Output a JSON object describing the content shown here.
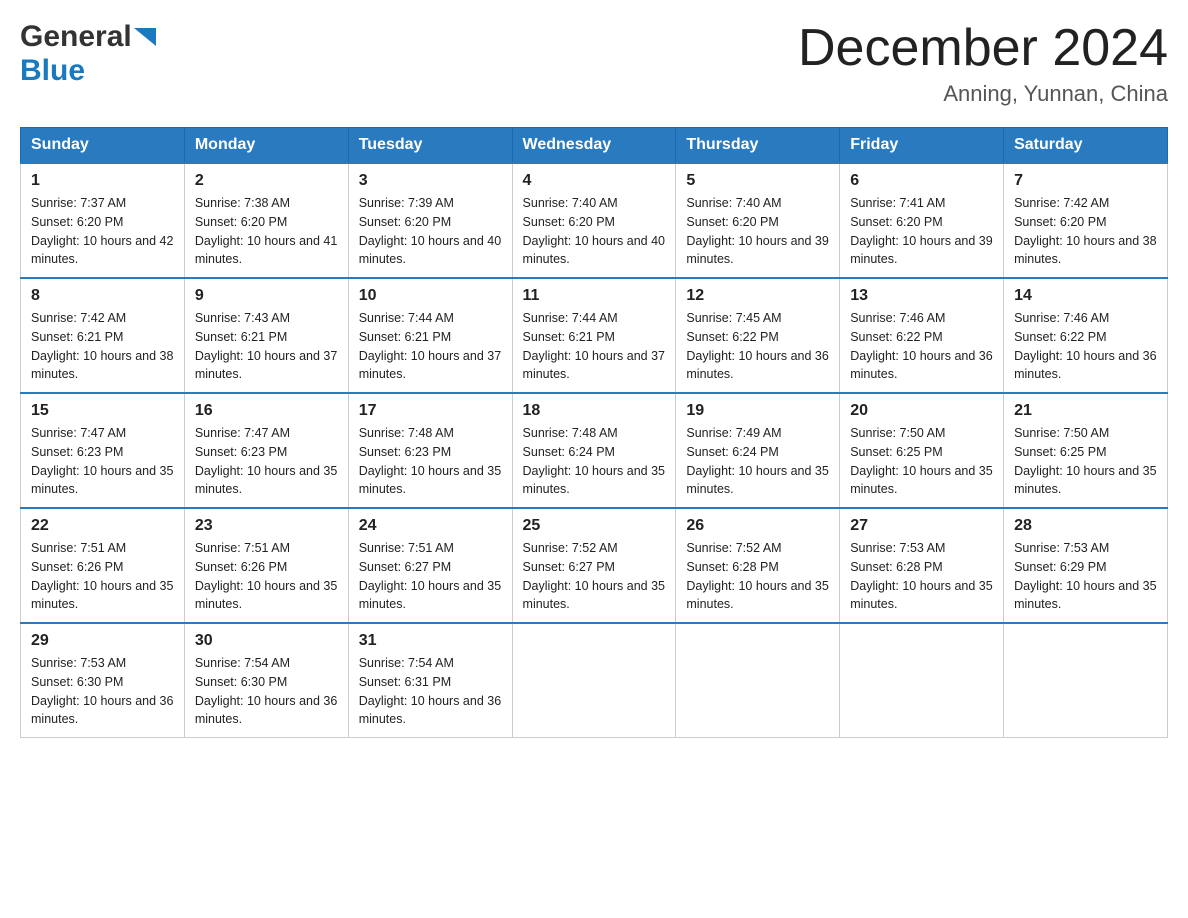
{
  "header": {
    "logo_general": "General",
    "logo_blue": "Blue",
    "month_year": "December 2024",
    "location": "Anning, Yunnan, China"
  },
  "weekdays": [
    "Sunday",
    "Monday",
    "Tuesday",
    "Wednesday",
    "Thursday",
    "Friday",
    "Saturday"
  ],
  "weeks": [
    [
      {
        "day": "1",
        "sunrise": "7:37 AM",
        "sunset": "6:20 PM",
        "daylight": "10 hours and 42 minutes."
      },
      {
        "day": "2",
        "sunrise": "7:38 AM",
        "sunset": "6:20 PM",
        "daylight": "10 hours and 41 minutes."
      },
      {
        "day": "3",
        "sunrise": "7:39 AM",
        "sunset": "6:20 PM",
        "daylight": "10 hours and 40 minutes."
      },
      {
        "day": "4",
        "sunrise": "7:40 AM",
        "sunset": "6:20 PM",
        "daylight": "10 hours and 40 minutes."
      },
      {
        "day": "5",
        "sunrise": "7:40 AM",
        "sunset": "6:20 PM",
        "daylight": "10 hours and 39 minutes."
      },
      {
        "day": "6",
        "sunrise": "7:41 AM",
        "sunset": "6:20 PM",
        "daylight": "10 hours and 39 minutes."
      },
      {
        "day": "7",
        "sunrise": "7:42 AM",
        "sunset": "6:20 PM",
        "daylight": "10 hours and 38 minutes."
      }
    ],
    [
      {
        "day": "8",
        "sunrise": "7:42 AM",
        "sunset": "6:21 PM",
        "daylight": "10 hours and 38 minutes."
      },
      {
        "day": "9",
        "sunrise": "7:43 AM",
        "sunset": "6:21 PM",
        "daylight": "10 hours and 37 minutes."
      },
      {
        "day": "10",
        "sunrise": "7:44 AM",
        "sunset": "6:21 PM",
        "daylight": "10 hours and 37 minutes."
      },
      {
        "day": "11",
        "sunrise": "7:44 AM",
        "sunset": "6:21 PM",
        "daylight": "10 hours and 37 minutes."
      },
      {
        "day": "12",
        "sunrise": "7:45 AM",
        "sunset": "6:22 PM",
        "daylight": "10 hours and 36 minutes."
      },
      {
        "day": "13",
        "sunrise": "7:46 AM",
        "sunset": "6:22 PM",
        "daylight": "10 hours and 36 minutes."
      },
      {
        "day": "14",
        "sunrise": "7:46 AM",
        "sunset": "6:22 PM",
        "daylight": "10 hours and 36 minutes."
      }
    ],
    [
      {
        "day": "15",
        "sunrise": "7:47 AM",
        "sunset": "6:23 PM",
        "daylight": "10 hours and 35 minutes."
      },
      {
        "day": "16",
        "sunrise": "7:47 AM",
        "sunset": "6:23 PM",
        "daylight": "10 hours and 35 minutes."
      },
      {
        "day": "17",
        "sunrise": "7:48 AM",
        "sunset": "6:23 PM",
        "daylight": "10 hours and 35 minutes."
      },
      {
        "day": "18",
        "sunrise": "7:48 AM",
        "sunset": "6:24 PM",
        "daylight": "10 hours and 35 minutes."
      },
      {
        "day": "19",
        "sunrise": "7:49 AM",
        "sunset": "6:24 PM",
        "daylight": "10 hours and 35 minutes."
      },
      {
        "day": "20",
        "sunrise": "7:50 AM",
        "sunset": "6:25 PM",
        "daylight": "10 hours and 35 minutes."
      },
      {
        "day": "21",
        "sunrise": "7:50 AM",
        "sunset": "6:25 PM",
        "daylight": "10 hours and 35 minutes."
      }
    ],
    [
      {
        "day": "22",
        "sunrise": "7:51 AM",
        "sunset": "6:26 PM",
        "daylight": "10 hours and 35 minutes."
      },
      {
        "day": "23",
        "sunrise": "7:51 AM",
        "sunset": "6:26 PM",
        "daylight": "10 hours and 35 minutes."
      },
      {
        "day": "24",
        "sunrise": "7:51 AM",
        "sunset": "6:27 PM",
        "daylight": "10 hours and 35 minutes."
      },
      {
        "day": "25",
        "sunrise": "7:52 AM",
        "sunset": "6:27 PM",
        "daylight": "10 hours and 35 minutes."
      },
      {
        "day": "26",
        "sunrise": "7:52 AM",
        "sunset": "6:28 PM",
        "daylight": "10 hours and 35 minutes."
      },
      {
        "day": "27",
        "sunrise": "7:53 AM",
        "sunset": "6:28 PM",
        "daylight": "10 hours and 35 minutes."
      },
      {
        "day": "28",
        "sunrise": "7:53 AM",
        "sunset": "6:29 PM",
        "daylight": "10 hours and 35 minutes."
      }
    ],
    [
      {
        "day": "29",
        "sunrise": "7:53 AM",
        "sunset": "6:30 PM",
        "daylight": "10 hours and 36 minutes."
      },
      {
        "day": "30",
        "sunrise": "7:54 AM",
        "sunset": "6:30 PM",
        "daylight": "10 hours and 36 minutes."
      },
      {
        "day": "31",
        "sunrise": "7:54 AM",
        "sunset": "6:31 PM",
        "daylight": "10 hours and 36 minutes."
      },
      null,
      null,
      null,
      null
    ]
  ]
}
